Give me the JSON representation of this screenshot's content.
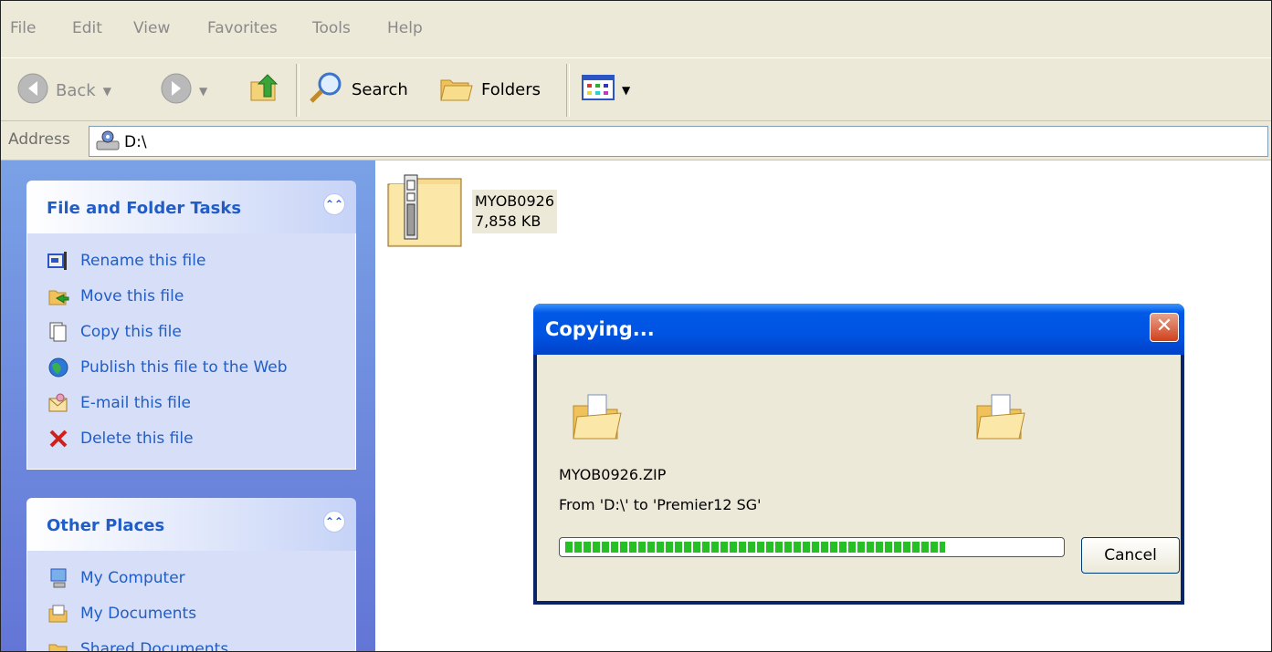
{
  "menu": [
    "File",
    "Edit",
    "View",
    "Favorites",
    "Tools",
    "Help"
  ],
  "toolbar": {
    "back_label": "Back",
    "search_label": "Search",
    "folders_label": "Folders"
  },
  "address": {
    "label": "Address",
    "value": "D:\\"
  },
  "file_tasks": {
    "title": "File and Folder Tasks",
    "items": [
      {
        "label": "Rename this file",
        "icon": "rename-icon"
      },
      {
        "label": "Move this file",
        "icon": "move-icon"
      },
      {
        "label": "Copy this file",
        "icon": "copy-icon"
      },
      {
        "label": "Publish this file to the Web",
        "icon": "globe-icon"
      },
      {
        "label": "E-mail this file",
        "icon": "email-icon"
      },
      {
        "label": "Delete this file",
        "icon": "delete-icon"
      }
    ]
  },
  "other_places": {
    "title": "Other Places",
    "items": [
      {
        "label": "My Computer",
        "icon": "computer-icon"
      },
      {
        "label": "My Documents",
        "icon": "documents-icon"
      },
      {
        "label": "Shared Documents",
        "icon": "folder-icon"
      }
    ]
  },
  "file": {
    "name": "MYOB0926",
    "size": "7,858 KB"
  },
  "dialog": {
    "title": "Copying...",
    "filename": "MYOB0926.ZIP",
    "from_text": "From 'D:\\' to 'Premier12 SG'",
    "progress": 0.77,
    "cancel_label": "Cancel"
  },
  "colors": {
    "task_link": "#215dc6",
    "progress_green": "#26c026",
    "title_blue": "#0054e3"
  }
}
